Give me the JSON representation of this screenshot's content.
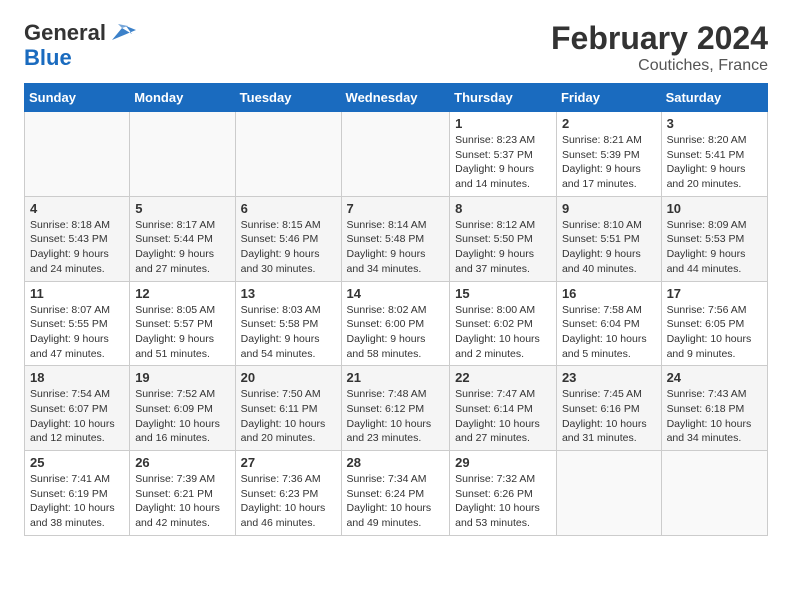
{
  "header": {
    "logo_line1": "General",
    "logo_line2": "Blue",
    "month": "February 2024",
    "location": "Coutiches, France"
  },
  "weekdays": [
    "Sunday",
    "Monday",
    "Tuesday",
    "Wednesday",
    "Thursday",
    "Friday",
    "Saturday"
  ],
  "weeks": [
    [
      {
        "day": "",
        "info": ""
      },
      {
        "day": "",
        "info": ""
      },
      {
        "day": "",
        "info": ""
      },
      {
        "day": "",
        "info": ""
      },
      {
        "day": "1",
        "info": "Sunrise: 8:23 AM\nSunset: 5:37 PM\nDaylight: 9 hours\nand 14 minutes."
      },
      {
        "day": "2",
        "info": "Sunrise: 8:21 AM\nSunset: 5:39 PM\nDaylight: 9 hours\nand 17 minutes."
      },
      {
        "day": "3",
        "info": "Sunrise: 8:20 AM\nSunset: 5:41 PM\nDaylight: 9 hours\nand 20 minutes."
      }
    ],
    [
      {
        "day": "4",
        "info": "Sunrise: 8:18 AM\nSunset: 5:43 PM\nDaylight: 9 hours\nand 24 minutes."
      },
      {
        "day": "5",
        "info": "Sunrise: 8:17 AM\nSunset: 5:44 PM\nDaylight: 9 hours\nand 27 minutes."
      },
      {
        "day": "6",
        "info": "Sunrise: 8:15 AM\nSunset: 5:46 PM\nDaylight: 9 hours\nand 30 minutes."
      },
      {
        "day": "7",
        "info": "Sunrise: 8:14 AM\nSunset: 5:48 PM\nDaylight: 9 hours\nand 34 minutes."
      },
      {
        "day": "8",
        "info": "Sunrise: 8:12 AM\nSunset: 5:50 PM\nDaylight: 9 hours\nand 37 minutes."
      },
      {
        "day": "9",
        "info": "Sunrise: 8:10 AM\nSunset: 5:51 PM\nDaylight: 9 hours\nand 40 minutes."
      },
      {
        "day": "10",
        "info": "Sunrise: 8:09 AM\nSunset: 5:53 PM\nDaylight: 9 hours\nand 44 minutes."
      }
    ],
    [
      {
        "day": "11",
        "info": "Sunrise: 8:07 AM\nSunset: 5:55 PM\nDaylight: 9 hours\nand 47 minutes."
      },
      {
        "day": "12",
        "info": "Sunrise: 8:05 AM\nSunset: 5:57 PM\nDaylight: 9 hours\nand 51 minutes."
      },
      {
        "day": "13",
        "info": "Sunrise: 8:03 AM\nSunset: 5:58 PM\nDaylight: 9 hours\nand 54 minutes."
      },
      {
        "day": "14",
        "info": "Sunrise: 8:02 AM\nSunset: 6:00 PM\nDaylight: 9 hours\nand 58 minutes."
      },
      {
        "day": "15",
        "info": "Sunrise: 8:00 AM\nSunset: 6:02 PM\nDaylight: 10 hours\nand 2 minutes."
      },
      {
        "day": "16",
        "info": "Sunrise: 7:58 AM\nSunset: 6:04 PM\nDaylight: 10 hours\nand 5 minutes."
      },
      {
        "day": "17",
        "info": "Sunrise: 7:56 AM\nSunset: 6:05 PM\nDaylight: 10 hours\nand 9 minutes."
      }
    ],
    [
      {
        "day": "18",
        "info": "Sunrise: 7:54 AM\nSunset: 6:07 PM\nDaylight: 10 hours\nand 12 minutes."
      },
      {
        "day": "19",
        "info": "Sunrise: 7:52 AM\nSunset: 6:09 PM\nDaylight: 10 hours\nand 16 minutes."
      },
      {
        "day": "20",
        "info": "Sunrise: 7:50 AM\nSunset: 6:11 PM\nDaylight: 10 hours\nand 20 minutes."
      },
      {
        "day": "21",
        "info": "Sunrise: 7:48 AM\nSunset: 6:12 PM\nDaylight: 10 hours\nand 23 minutes."
      },
      {
        "day": "22",
        "info": "Sunrise: 7:47 AM\nSunset: 6:14 PM\nDaylight: 10 hours\nand 27 minutes."
      },
      {
        "day": "23",
        "info": "Sunrise: 7:45 AM\nSunset: 6:16 PM\nDaylight: 10 hours\nand 31 minutes."
      },
      {
        "day": "24",
        "info": "Sunrise: 7:43 AM\nSunset: 6:18 PM\nDaylight: 10 hours\nand 34 minutes."
      }
    ],
    [
      {
        "day": "25",
        "info": "Sunrise: 7:41 AM\nSunset: 6:19 PM\nDaylight: 10 hours\nand 38 minutes."
      },
      {
        "day": "26",
        "info": "Sunrise: 7:39 AM\nSunset: 6:21 PM\nDaylight: 10 hours\nand 42 minutes."
      },
      {
        "day": "27",
        "info": "Sunrise: 7:36 AM\nSunset: 6:23 PM\nDaylight: 10 hours\nand 46 minutes."
      },
      {
        "day": "28",
        "info": "Sunrise: 7:34 AM\nSunset: 6:24 PM\nDaylight: 10 hours\nand 49 minutes."
      },
      {
        "day": "29",
        "info": "Sunrise: 7:32 AM\nSunset: 6:26 PM\nDaylight: 10 hours\nand 53 minutes."
      },
      {
        "day": "",
        "info": ""
      },
      {
        "day": "",
        "info": ""
      }
    ]
  ]
}
